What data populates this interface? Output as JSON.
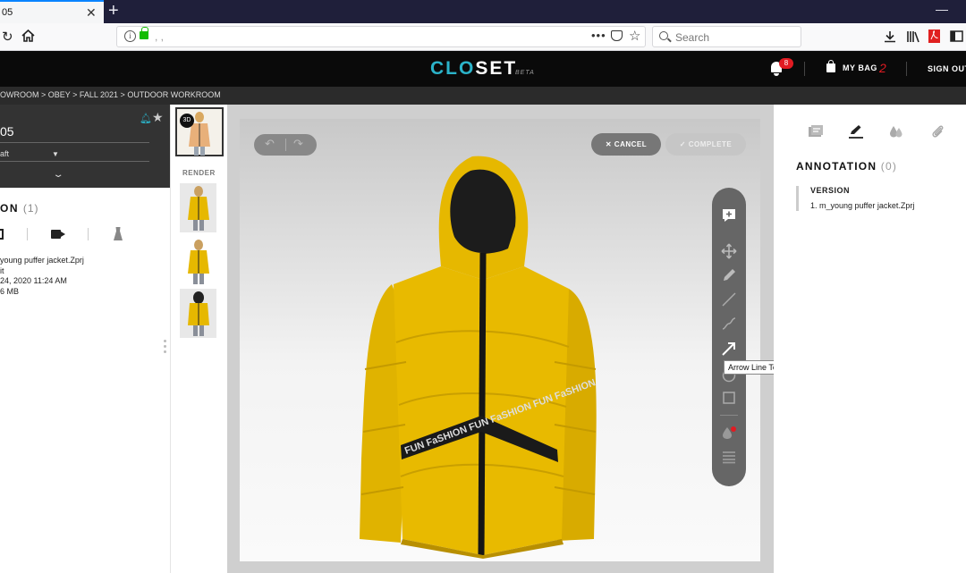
{
  "browser": {
    "tab_title": "05",
    "tab_close": "✕",
    "new_tab": "+",
    "min_button": "—",
    "url_text": ",              ,",
    "url_dots": "•••",
    "search_placeholder": "Search"
  },
  "app": {
    "logo_clo": "CLO",
    "logo_set": "SET",
    "logo_beta": "BETA",
    "notification_count": "8",
    "my_bag_label": "MY BAG",
    "bag_count": "2",
    "sign_out": "SIGN OUT",
    "accent_color": "#2bb3c9",
    "alert_color": "#e11b22"
  },
  "breadcrumb": "OWROOM > OBEY > FALL 2021 > OUTDOOR WORKROOM",
  "left_panel": {
    "title": "05",
    "state": "aft",
    "version_label": "ON",
    "version_count": "(1)",
    "file_name": "young puffer jacket.Zprj",
    "status": "it",
    "date": "24, 2020 11:24 AM",
    "size": "6 MB"
  },
  "thumbnails": {
    "badge": "3D",
    "render_label": "RENDER"
  },
  "viewer": {
    "cancel_label": "CANCEL",
    "complete_label": "COMPLETE",
    "tooltip": "Arrow Line Tool (A)",
    "jacket_text": "FUN FaSHION FUN FaSHION FUN FaSHION"
  },
  "right_panel": {
    "title": "ANNOTATION",
    "count": "(0)",
    "version_label": "VERSION",
    "version_item": "1. m_young puffer jacket.Zprj"
  }
}
